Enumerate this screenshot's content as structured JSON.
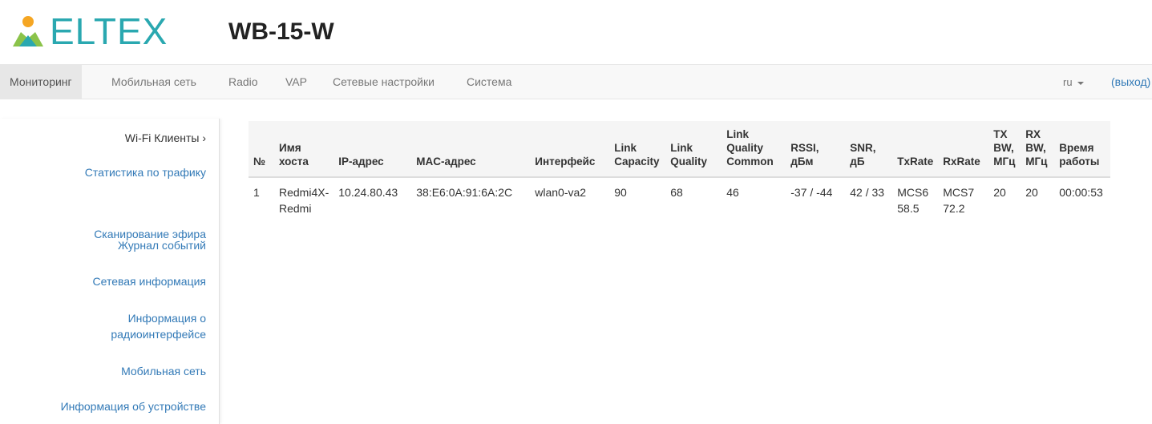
{
  "header": {
    "logo_text": "ELTEX",
    "model": "WB-15-W"
  },
  "navbar": {
    "items": [
      {
        "label": "Мониторинг",
        "active": true
      },
      {
        "label": "Мобильная сеть",
        "active": false
      },
      {
        "label": "Radio",
        "active": false
      },
      {
        "label": "VAP",
        "active": false
      },
      {
        "label": "Сетевые настройки",
        "active": false
      },
      {
        "label": "Система",
        "active": false
      }
    ],
    "language": "ru",
    "logout": "(выход)"
  },
  "sidebar": {
    "items": [
      {
        "label": "Wi-Fi Клиенты ›",
        "active": true
      },
      {
        "label": "Статистика по трафику",
        "active": false
      },
      {
        "label": "Сканирование эфира",
        "active": false
      },
      {
        "label": "Журнал событий",
        "active": false
      },
      {
        "label": "Сетевая информация",
        "active": false
      },
      {
        "label": "Информация о радиоинтерфейсе",
        "active": false
      },
      {
        "label": "Мобильная сеть",
        "active": false
      },
      {
        "label": "Информация об устройстве",
        "active": false
      }
    ]
  },
  "clients_table": {
    "columns": [
      "№",
      "Имя хоста",
      "IP-адрес",
      "MAC-адрес",
      "Интерфейс",
      "Link Capacity",
      "Link Quality",
      "Link Quality Common",
      "RSSI, дБм",
      "SNR, дБ",
      "TxRate",
      "RxRate",
      "TX BW, МГц",
      "RX BW, МГц",
      "Время работы"
    ],
    "rows": [
      [
        "1",
        "Redmi4X-Redmi",
        "10.24.80.43",
        "38:E6:0A:91:6A:2C",
        "wlan0-va2",
        "90",
        "68",
        "46",
        "-37 / -44",
        "42 / 33",
        "MCS6 58.5",
        "MCS7 72.2",
        "20",
        "20",
        "00:00:53"
      ]
    ]
  },
  "colors": {
    "brand": "#2aa8b0",
    "link": "#337ab7",
    "navbar_bg": "#f8f8f8",
    "nav_active_bg": "#e7e7e7"
  }
}
